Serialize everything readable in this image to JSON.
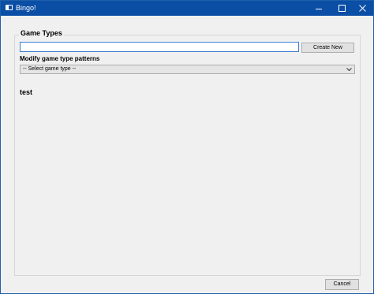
{
  "window": {
    "title": "Bingo!"
  },
  "game_types": {
    "heading": "Game Types",
    "name_input": {
      "value": "",
      "placeholder": ""
    },
    "create_button_label": "Create New"
  },
  "modify": {
    "label": "Modify game type patterns",
    "select": {
      "selected": "-- Select game type --"
    }
  },
  "test_heading": "test",
  "footer": {
    "cancel_label": "Cancel"
  },
  "colors": {
    "titlebar": "#0a4ea6",
    "input_focus_border": "#3c7fd4"
  }
}
